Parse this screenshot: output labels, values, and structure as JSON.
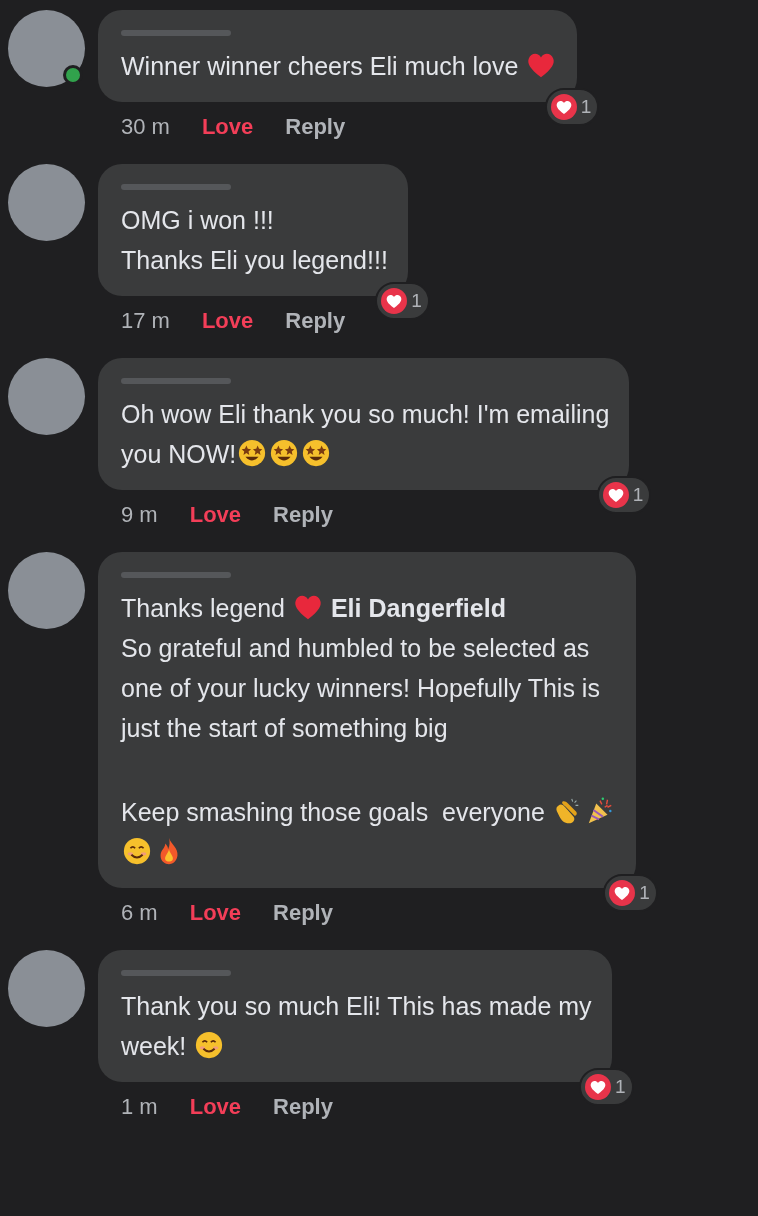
{
  "comments": [
    {
      "online": true,
      "lines": [
        {
          "parts": [
            {
              "kind": "text",
              "text": "Winner winner cheers Eli much love "
            },
            {
              "kind": "heart"
            }
          ]
        }
      ],
      "time": "30 m",
      "love": "Love",
      "reply": "Reply",
      "reaction_count": "1"
    },
    {
      "online": false,
      "lines": [
        {
          "parts": [
            {
              "kind": "text",
              "text": "OMG i won !!!"
            }
          ]
        },
        {
          "parts": [
            {
              "kind": "text",
              "text": "Thanks Eli you legend!!!"
            }
          ]
        }
      ],
      "time": "17 m",
      "love": "Love",
      "reply": "Reply",
      "reaction_count": "1"
    },
    {
      "online": false,
      "lines": [
        {
          "parts": [
            {
              "kind": "text",
              "text": "Oh wow Eli thank you so much! I'm emailing"
            }
          ]
        },
        {
          "parts": [
            {
              "kind": "text",
              "text": "you NOW!"
            },
            {
              "kind": "starstruck"
            },
            {
              "kind": "starstruck"
            },
            {
              "kind": "starstruck"
            }
          ]
        }
      ],
      "time": "9 m",
      "love": "Love",
      "reply": "Reply",
      "reaction_count": "1"
    },
    {
      "online": false,
      "lines": [
        {
          "parts": [
            {
              "kind": "text",
              "text": "Thanks legend "
            },
            {
              "kind": "heart"
            },
            {
              "kind": "mention",
              "text": " Eli Dangerfield"
            }
          ]
        },
        {
          "parts": [
            {
              "kind": "text",
              "text": "So grateful and humbled to be selected as"
            }
          ]
        },
        {
          "parts": [
            {
              "kind": "text",
              "text": "one of your lucky winners! Hopefully This is"
            }
          ]
        },
        {
          "parts": [
            {
              "kind": "text",
              "text": "just the start of something big"
            }
          ]
        },
        {
          "spaced": true,
          "parts": [
            {
              "kind": "text",
              "text": "Keep smashing those goals  everyone "
            },
            {
              "kind": "clap"
            },
            {
              "kind": "party"
            }
          ]
        },
        {
          "parts": [
            {
              "kind": "smile"
            },
            {
              "kind": "fire"
            }
          ]
        }
      ],
      "time": "6 m",
      "love": "Love",
      "reply": "Reply",
      "reaction_count": "1"
    },
    {
      "online": false,
      "lines": [
        {
          "parts": [
            {
              "kind": "text",
              "text": "Thank you so much Eli! This has made my"
            }
          ]
        },
        {
          "parts": [
            {
              "kind": "text",
              "text": "week! "
            },
            {
              "kind": "smile"
            }
          ]
        }
      ],
      "time": "1 m",
      "love": "Love",
      "reply": "Reply",
      "reaction_count": "1"
    }
  ]
}
